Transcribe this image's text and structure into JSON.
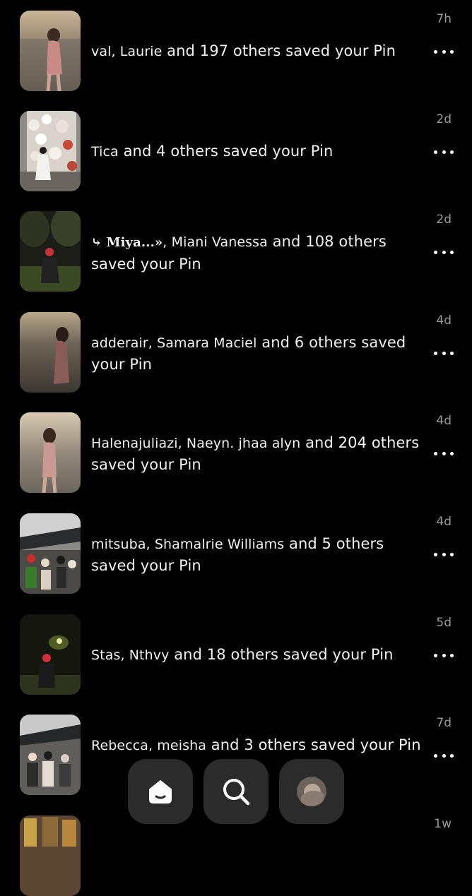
{
  "notifications": [
    {
      "names": "val, Laurie",
      "rest": " and 197 others saved your Pin",
      "time": "7h"
    },
    {
      "names": "Tica",
      "rest": " and 4 others saved your Pin",
      "time": "2d"
    },
    {
      "names_prefix": "⤷ Miya...»",
      "names": ", Miani Vanessa",
      "rest": " and 108 others saved your Pin",
      "time": "2d"
    },
    {
      "names": "adderair, Samara Maciel",
      "rest": " and 6 others saved your Pin",
      "time": "4d"
    },
    {
      "names": "Halenajuliazi, Naeyn. jhaa alyn",
      "rest": " and 204 others saved your Pin",
      "time": "4d"
    },
    {
      "names": "mitsuba, Shamalrie Williams",
      "rest": " and 5 others saved your Pin",
      "time": "4d"
    },
    {
      "names": "Stas, Nthvy",
      "rest": " and 18 others saved your Pin",
      "time": "5d"
    },
    {
      "names": "Rebecca, meisha",
      "rest": " and 3 others saved your Pin",
      "time": "7d"
    },
    {
      "time": "1w"
    }
  ],
  "nav": {
    "items": [
      "home",
      "search",
      "profile"
    ]
  },
  "icons": {
    "more": "more-horizontal-icon",
    "home": "home-icon",
    "search": "search-icon"
  },
  "colors": {
    "background": "#000000",
    "text": "#f2f2f2",
    "timestamp": "#9a9a9a",
    "nav_button": "#2b2b2b"
  }
}
